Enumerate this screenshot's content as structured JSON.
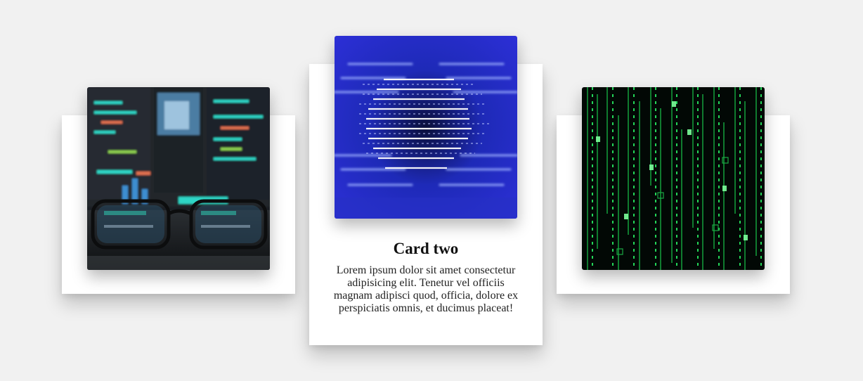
{
  "cards": [
    {
      "image": {
        "icon": "code-monitor-with-glasses-image",
        "accent": "#2fd6c6"
      },
      "title": "",
      "text": ""
    },
    {
      "image": {
        "icon": "blurred-blue-code-image",
        "accent": "#2b34d9"
      },
      "title": "Card two",
      "text": "Lorem ipsum dolor sit amet consectetur adipisicing elit. Tenetur vel officiis magnam adipisci quod, officia, dolore ex perspiciatis omnis, et ducimus placeat!"
    },
    {
      "image": {
        "icon": "green-matrix-code-image",
        "accent": "#19c94a"
      },
      "title": "",
      "text": ""
    }
  ],
  "colors": {
    "background": "#f1f1f1",
    "card": "#ffffff"
  }
}
